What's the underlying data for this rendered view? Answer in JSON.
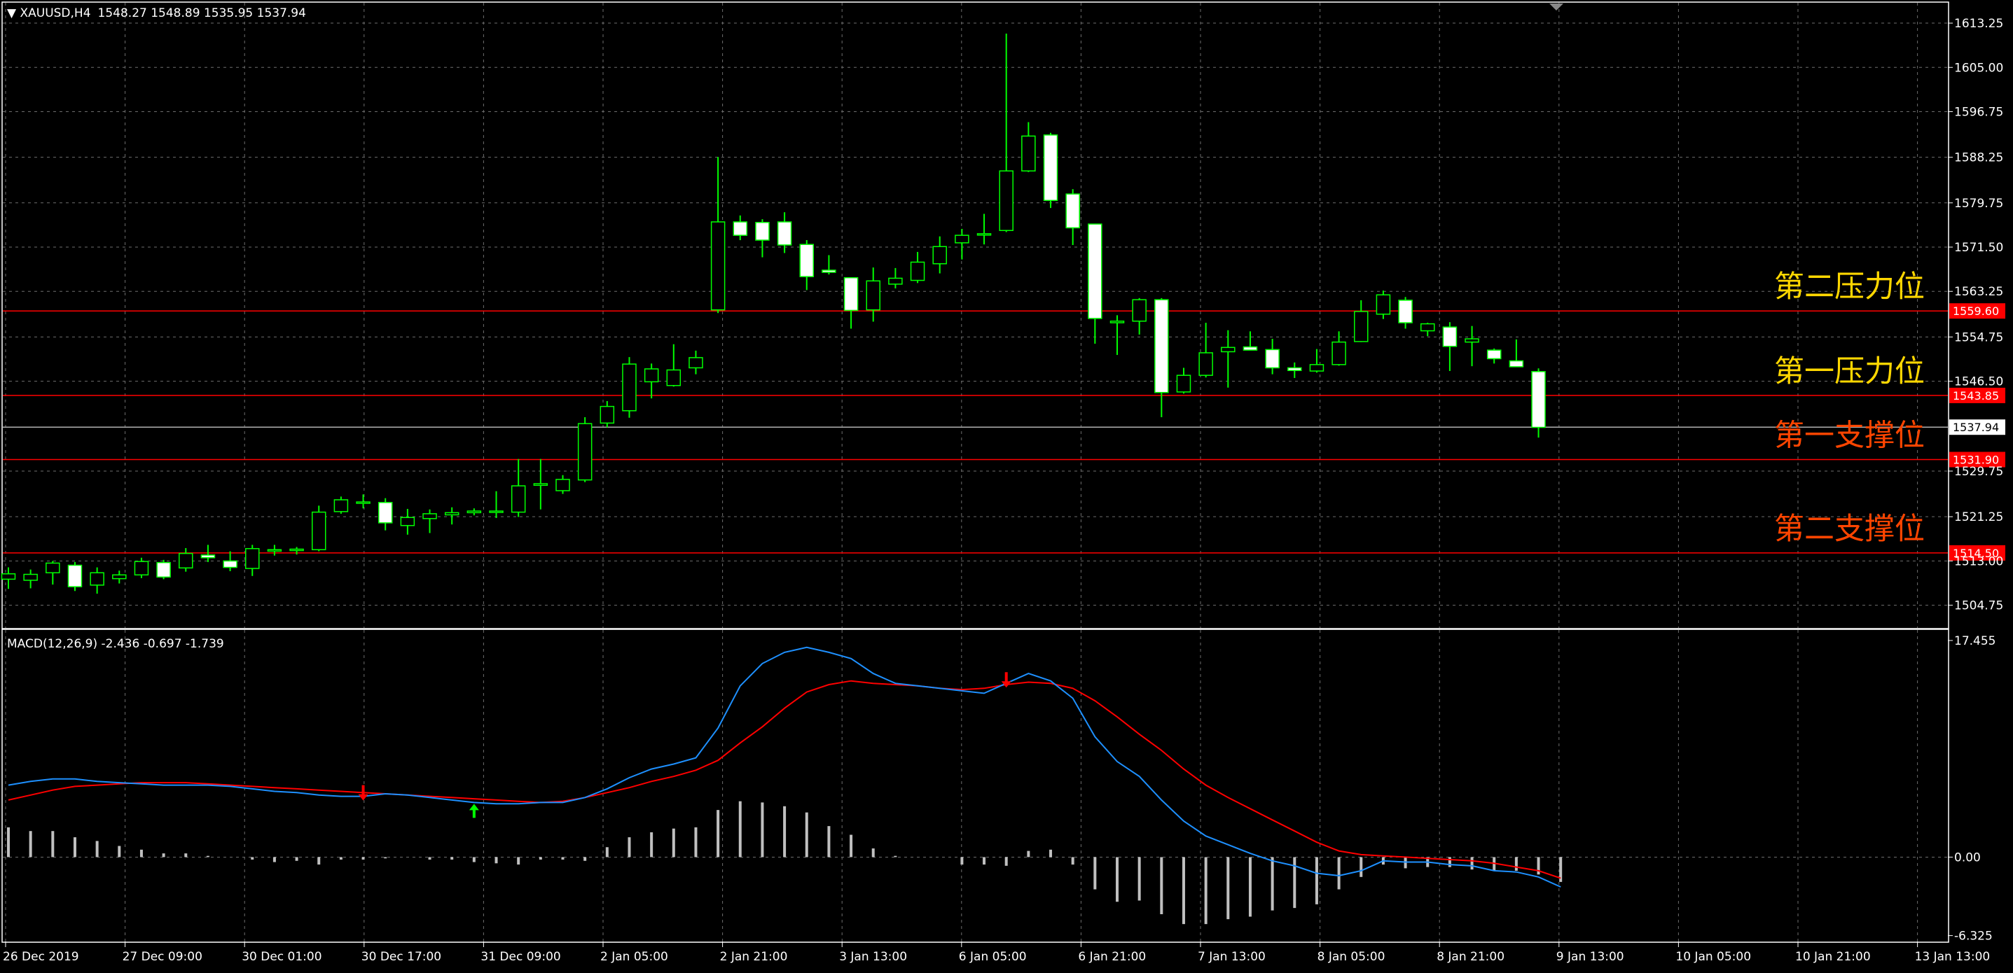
{
  "header": {
    "symbol": "XAUUSD,H4",
    "ohlc": "1548.27 1548.89 1535.95 1537.94"
  },
  "macd_header": {
    "label": "MACD(12,26,9) -2.436 -0.697 -1.739"
  },
  "colors": {
    "background": "#000000",
    "frame": "#ffffff",
    "grid": "#6e6e6e",
    "bull_candle": "#00ff00",
    "bull_body": "#000000",
    "bear_body": "#ffffff",
    "resistance_line": "#ff0000",
    "macd_line": "#1e90ff",
    "signal_line": "#ff0000",
    "histogram": "#c0c0c0",
    "annotation_yellow": "#ffd700",
    "annotation_orange": "#ff4500"
  },
  "chart_data": [
    {
      "type": "candlestick",
      "symbol": "XAUUSD",
      "timeframe": "H4",
      "ylim": [
        1500.52,
        1617.04
      ],
      "y_ticks": [
        {
          "value": 1613.25,
          "label": "1613.25"
        },
        {
          "value": 1605.0,
          "label": "1605.00"
        },
        {
          "value": 1596.75,
          "label": "1596.75"
        },
        {
          "value": 1588.25,
          "label": "1588.25"
        },
        {
          "value": 1579.75,
          "label": "1579.75"
        },
        {
          "value": 1571.5,
          "label": "1571.50"
        },
        {
          "value": 1563.25,
          "label": "1563.25"
        },
        {
          "value": 1554.75,
          "label": "1554.75"
        },
        {
          "value": 1546.5,
          "label": "1546.50"
        },
        {
          "value": 1529.75,
          "label": "1529.75"
        },
        {
          "value": 1521.25,
          "label": "1521.25"
        },
        {
          "value": 1513.0,
          "label": "1513.00"
        },
        {
          "value": 1504.75,
          "label": "1504.75"
        }
      ],
      "x_ticks": [
        "26 Dec 2019",
        "27 Dec 09:00",
        "30 Dec 01:00",
        "30 Dec 17:00",
        "31 Dec 09:00",
        "2 Jan 05:00",
        "2 Jan 21:00",
        "3 Jan 13:00",
        "6 Jan 05:00",
        "6 Jan 21:00",
        "7 Jan 13:00",
        "8 Jan 05:00",
        "8 Jan 21:00",
        "9 Jan 13:00",
        "10 Jan 05:00",
        "10 Jan 21:00",
        "13 Jan 13:00"
      ],
      "candles": [
        {
          "o": 1509.6,
          "h": 1511.8,
          "l": 1507.8,
          "c": 1510.6
        },
        {
          "o": 1509.4,
          "h": 1511.4,
          "l": 1507.9,
          "c": 1510.5
        },
        {
          "o": 1510.8,
          "h": 1513.0,
          "l": 1508.6,
          "c": 1512.6
        },
        {
          "o": 1512.2,
          "h": 1512.8,
          "l": 1507.4,
          "c": 1508.2
        },
        {
          "o": 1508.5,
          "h": 1511.8,
          "l": 1506.9,
          "c": 1510.8
        },
        {
          "o": 1509.7,
          "h": 1511.2,
          "l": 1508.8,
          "c": 1510.4
        },
        {
          "o": 1510.4,
          "h": 1513.6,
          "l": 1509.8,
          "c": 1512.9
        },
        {
          "o": 1512.7,
          "h": 1513.2,
          "l": 1509.6,
          "c": 1510.0
        },
        {
          "o": 1511.7,
          "h": 1515.4,
          "l": 1511.0,
          "c": 1514.4
        },
        {
          "o": 1514.1,
          "h": 1516.0,
          "l": 1512.8,
          "c": 1513.6
        },
        {
          "o": 1513.0,
          "h": 1514.8,
          "l": 1511.1,
          "c": 1511.8
        },
        {
          "o": 1511.6,
          "h": 1516.0,
          "l": 1510.2,
          "c": 1515.3
        },
        {
          "o": 1515.1,
          "h": 1516.0,
          "l": 1514.0,
          "c": 1515.1
        },
        {
          "o": 1515.0,
          "h": 1515.6,
          "l": 1514.2,
          "c": 1515.2
        },
        {
          "o": 1515.1,
          "h": 1523.3,
          "l": 1514.8,
          "c": 1522.1
        },
        {
          "o": 1522.2,
          "h": 1525.0,
          "l": 1521.8,
          "c": 1524.4
        },
        {
          "o": 1524.0,
          "h": 1525.4,
          "l": 1522.8,
          "c": 1524.0
        },
        {
          "o": 1523.9,
          "h": 1524.7,
          "l": 1518.7,
          "c": 1520.1
        },
        {
          "o": 1519.6,
          "h": 1522.7,
          "l": 1517.9,
          "c": 1521.1
        },
        {
          "o": 1520.9,
          "h": 1522.6,
          "l": 1518.2,
          "c": 1521.8
        },
        {
          "o": 1521.6,
          "h": 1523.0,
          "l": 1519.8,
          "c": 1522.0
        },
        {
          "o": 1522.0,
          "h": 1522.8,
          "l": 1521.5,
          "c": 1522.3
        },
        {
          "o": 1522.3,
          "h": 1526.0,
          "l": 1521.0,
          "c": 1522.3
        },
        {
          "o": 1522.1,
          "h": 1532.0,
          "l": 1521.2,
          "c": 1527.0
        },
        {
          "o": 1527.1,
          "h": 1532.0,
          "l": 1522.6,
          "c": 1527.4
        },
        {
          "o": 1526.1,
          "h": 1529.0,
          "l": 1525.5,
          "c": 1528.2
        },
        {
          "o": 1528.1,
          "h": 1539.8,
          "l": 1527.7,
          "c": 1538.6
        },
        {
          "o": 1538.7,
          "h": 1542.8,
          "l": 1537.9,
          "c": 1541.8
        },
        {
          "o": 1541.0,
          "h": 1551.0,
          "l": 1539.7,
          "c": 1549.7
        },
        {
          "o": 1546.4,
          "h": 1549.8,
          "l": 1543.3,
          "c": 1548.8
        },
        {
          "o": 1545.7,
          "h": 1553.4,
          "l": 1545.5,
          "c": 1548.6
        },
        {
          "o": 1549.0,
          "h": 1552.2,
          "l": 1547.8,
          "c": 1550.9
        },
        {
          "o": 1559.8,
          "h": 1588.3,
          "l": 1559.2,
          "c": 1576.2
        },
        {
          "o": 1576.2,
          "h": 1577.4,
          "l": 1572.8,
          "c": 1573.7
        },
        {
          "o": 1576.1,
          "h": 1576.7,
          "l": 1569.6,
          "c": 1572.8
        },
        {
          "o": 1576.2,
          "h": 1578.0,
          "l": 1570.4,
          "c": 1571.9
        },
        {
          "o": 1572.0,
          "h": 1572.8,
          "l": 1563.5,
          "c": 1566.0
        },
        {
          "o": 1567.2,
          "h": 1570.0,
          "l": 1566.4,
          "c": 1566.8
        },
        {
          "o": 1565.8,
          "h": 1565.8,
          "l": 1556.3,
          "c": 1559.7
        },
        {
          "o": 1559.8,
          "h": 1567.7,
          "l": 1557.6,
          "c": 1565.2
        },
        {
          "o": 1564.6,
          "h": 1567.6,
          "l": 1563.8,
          "c": 1565.7
        },
        {
          "o": 1565.3,
          "h": 1570.6,
          "l": 1564.8,
          "c": 1568.7
        },
        {
          "o": 1568.4,
          "h": 1573.5,
          "l": 1566.6,
          "c": 1571.6
        },
        {
          "o": 1572.3,
          "h": 1574.9,
          "l": 1569.2,
          "c": 1573.7
        },
        {
          "o": 1573.8,
          "h": 1577.7,
          "l": 1572.0,
          "c": 1574.0
        },
        {
          "o": 1574.6,
          "h": 1611.3,
          "l": 1574.3,
          "c": 1585.7
        },
        {
          "o": 1585.7,
          "h": 1594.8,
          "l": 1585.5,
          "c": 1592.2
        },
        {
          "o": 1592.4,
          "h": 1592.8,
          "l": 1578.8,
          "c": 1580.2
        },
        {
          "o": 1581.4,
          "h": 1582.3,
          "l": 1571.9,
          "c": 1575.1
        },
        {
          "o": 1575.8,
          "h": 1575.8,
          "l": 1553.5,
          "c": 1558.2
        },
        {
          "o": 1557.4,
          "h": 1558.8,
          "l": 1551.4,
          "c": 1557.7
        },
        {
          "o": 1557.7,
          "h": 1562.0,
          "l": 1555.2,
          "c": 1561.7
        },
        {
          "o": 1561.7,
          "h": 1562.0,
          "l": 1539.8,
          "c": 1544.4
        },
        {
          "o": 1544.5,
          "h": 1549.0,
          "l": 1544.2,
          "c": 1547.6
        },
        {
          "o": 1547.6,
          "h": 1557.4,
          "l": 1547.2,
          "c": 1551.8
        },
        {
          "o": 1552.0,
          "h": 1556.0,
          "l": 1545.3,
          "c": 1552.8
        },
        {
          "o": 1552.9,
          "h": 1555.8,
          "l": 1552.3,
          "c": 1552.3
        },
        {
          "o": 1552.4,
          "h": 1554.4,
          "l": 1547.8,
          "c": 1549.0
        },
        {
          "o": 1549.0,
          "h": 1550.0,
          "l": 1547.1,
          "c": 1548.5
        },
        {
          "o": 1548.4,
          "h": 1552.5,
          "l": 1548.1,
          "c": 1549.6
        },
        {
          "o": 1549.6,
          "h": 1555.8,
          "l": 1549.4,
          "c": 1553.8
        },
        {
          "o": 1553.9,
          "h": 1561.6,
          "l": 1553.8,
          "c": 1559.5
        },
        {
          "o": 1559.0,
          "h": 1563.4,
          "l": 1558.1,
          "c": 1562.6
        },
        {
          "o": 1561.6,
          "h": 1562.2,
          "l": 1556.3,
          "c": 1557.4
        },
        {
          "o": 1555.9,
          "h": 1557.4,
          "l": 1554.9,
          "c": 1557.2
        },
        {
          "o": 1556.6,
          "h": 1557.5,
          "l": 1548.4,
          "c": 1553.0
        },
        {
          "o": 1553.8,
          "h": 1556.8,
          "l": 1549.3,
          "c": 1554.4
        },
        {
          "o": 1552.3,
          "h": 1552.6,
          "l": 1549.8,
          "c": 1550.7
        },
        {
          "o": 1550.3,
          "h": 1554.3,
          "l": 1549.5,
          "c": 1549.2
        },
        {
          "o": 1548.3,
          "h": 1548.9,
          "l": 1536.0,
          "c": 1537.9
        }
      ],
      "levels": [
        {
          "value": 1559.6,
          "label": "1559.60",
          "annotation": "第二压力位",
          "annotation_color": "#ffd700"
        },
        {
          "value": 1543.85,
          "label": "1543.85",
          "annotation": "第一压力位",
          "annotation_color": "#ffd700"
        },
        {
          "value": 1531.9,
          "label": "1531.90",
          "annotation": "第一支撑位",
          "annotation_color": "#ff4500"
        },
        {
          "value": 1514.5,
          "label": "1514.50",
          "annotation": "第二支撑位",
          "annotation_color": "#ff4500"
        }
      ],
      "current_price": {
        "value": 1537.94,
        "label": "1537.94"
      }
    },
    {
      "type": "macd",
      "params": "12,26,9",
      "ylim": [
        -6.8,
        18.3
      ],
      "y_ticks": [
        {
          "value": 17.455,
          "label": "17.455"
        },
        {
          "value": 0.0,
          "label": "0.00"
        },
        {
          "value": -6.325,
          "label": "-6.325"
        }
      ],
      "macd": [
        5.8,
        6.1,
        6.3,
        6.3,
        6.1,
        6.0,
        5.9,
        5.8,
        5.8,
        5.8,
        5.7,
        5.5,
        5.3,
        5.2,
        5.0,
        4.9,
        4.9,
        5.1,
        5.0,
        4.8,
        4.6,
        4.4,
        4.3,
        4.3,
        4.4,
        4.4,
        4.8,
        5.5,
        6.4,
        7.1,
        7.5,
        8.0,
        10.4,
        13.8,
        15.6,
        16.5,
        16.9,
        16.5,
        16.0,
        14.8,
        14.0,
        13.8,
        13.6,
        13.4,
        13.2,
        14.0,
        14.8,
        14.2,
        12.8,
        9.7,
        7.7,
        6.5,
        4.6,
        2.9,
        1.7,
        1.0,
        0.3,
        -0.3,
        -0.7,
        -1.3,
        -1.5,
        -1.1,
        -0.3,
        -0.4,
        -0.4,
        -0.6,
        -0.7,
        -1.1,
        -1.2,
        -1.6,
        -2.4
      ],
      "signal": [
        4.6,
        5.0,
        5.4,
        5.7,
        5.8,
        5.9,
        6.0,
        6.0,
        6.0,
        5.9,
        5.8,
        5.7,
        5.6,
        5.5,
        5.4,
        5.3,
        5.2,
        5.1,
        5.0,
        4.9,
        4.8,
        4.7,
        4.6,
        4.5,
        4.4,
        4.5,
        4.8,
        5.2,
        5.6,
        6.1,
        6.5,
        7.0,
        7.8,
        9.2,
        10.5,
        12.0,
        13.3,
        13.9,
        14.2,
        14.0,
        13.9,
        13.8,
        13.6,
        13.5,
        13.6,
        13.9,
        14.1,
        14.0,
        13.6,
        12.6,
        11.3,
        9.9,
        8.6,
        7.1,
        5.8,
        4.8,
        3.9,
        3.0,
        2.1,
        1.2,
        0.5,
        0.2,
        0.1,
        0.0,
        -0.1,
        -0.2,
        -0.3,
        -0.5,
        -0.8,
        -1.1,
        -1.7
      ],
      "histogram": [
        2.4,
        2.1,
        2.1,
        1.6,
        1.3,
        0.9,
        0.6,
        0.3,
        0.3,
        0.1,
        0.0,
        -0.2,
        -0.4,
        -0.3,
        -0.6,
        -0.2,
        -0.2,
        -0.1,
        0.0,
        -0.2,
        -0.2,
        -0.4,
        -0.5,
        -0.6,
        -0.2,
        -0.2,
        -0.3,
        0.8,
        1.6,
        2.0,
        2.3,
        2.4,
        3.8,
        4.5,
        4.4,
        4.1,
        3.6,
        2.5,
        1.8,
        0.7,
        0.1,
        0.0,
        0.0,
        -0.6,
        -0.6,
        -0.7,
        0.5,
        0.6,
        -0.6,
        -2.6,
        -3.6,
        -3.5,
        -4.6,
        -5.4,
        -5.4,
        -5.0,
        -4.8,
        -4.3,
        -4.1,
        -3.8,
        -2.6,
        -1.6,
        -0.6,
        -0.9,
        -0.8,
        -0.8,
        -1.0,
        -1.1,
        -1.1,
        -1.4,
        -2.0
      ],
      "crossovers": [
        {
          "index": 16,
          "direction": "down",
          "color": "#ff0000"
        },
        {
          "index": 21,
          "direction": "up",
          "color": "#00ff00"
        },
        {
          "index": 45,
          "direction": "down",
          "color": "#ff0000"
        }
      ]
    }
  ]
}
